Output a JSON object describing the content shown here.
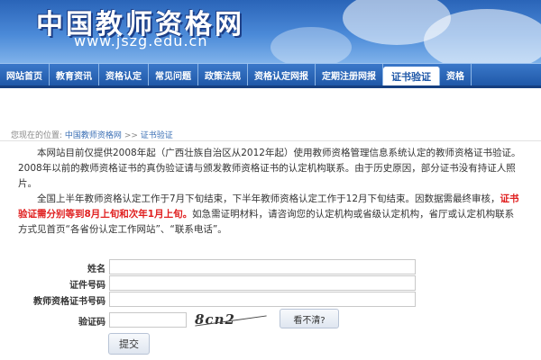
{
  "header": {
    "site_title": "中国教师资格网",
    "site_url": "www.jszg.edu.cn"
  },
  "nav": {
    "items": [
      {
        "label": "网站首页"
      },
      {
        "label": "教育资讯"
      },
      {
        "label": "资格认定"
      },
      {
        "label": "常见问题"
      },
      {
        "label": "政策法规"
      },
      {
        "label": "资格认定网报"
      },
      {
        "label": "定期注册网报"
      },
      {
        "label": "证书验证",
        "active": true
      },
      {
        "label": "资格"
      }
    ]
  },
  "breadcrumb": {
    "prefix": "您现在的位置:",
    "home": "中国教师资格网",
    "separator": ">>",
    "current": "证书验证"
  },
  "notice": {
    "para1": "本网站目前仅提供2008年起（广西壮族自治区从2012年起）使用教师资格管理信息系统认定的教师资格证书验证。2008年以前的教师资格证书的真伪验证请与颁发教师资格证书的认定机构联系。由于历史原因，部分证书没有持证人照片。",
    "para2_a": "全国上半年教师资格认定工作于7月下旬结束，下半年教师资格认定工作于12月下旬结束。因数据需最终审核，",
    "para2_red": "证书验证需分别等到8月上旬和次年1月上旬。",
    "para2_b": "如急需证明材料，请咨询您的认定机构或省级认定机构，省厅或认定机构联系方式见首页“各省份认定工作网站”、“联系电话”。"
  },
  "form": {
    "name_label": "姓名",
    "id_label": "证件号码",
    "cert_label": "教师资格证书号码",
    "captcha_label": "验证码",
    "captcha_text": "8cn2",
    "refresh_label": "看不清?",
    "submit_label": "提交"
  }
}
